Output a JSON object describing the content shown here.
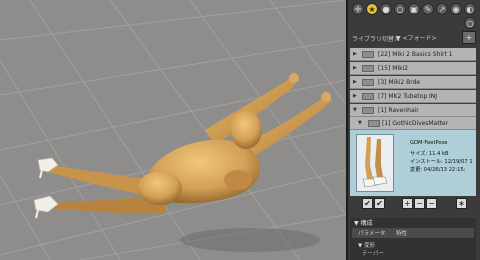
{
  "viewport": {
    "label": "3D viewport"
  },
  "toolbar": {
    "tools": [
      {
        "name": "pose-tool-icon",
        "glyph": "✛",
        "active": false
      },
      {
        "name": "library-tool-icon",
        "glyph": "★",
        "active": true
      },
      {
        "name": "sphere-tool-icon",
        "glyph": "●",
        "active": false
      },
      {
        "name": "light-tool-icon",
        "glyph": "○",
        "active": false
      },
      {
        "name": "camera-tool-icon",
        "glyph": "▣",
        "active": false
      },
      {
        "name": "paint-tool-icon",
        "glyph": "✎",
        "active": false
      },
      {
        "name": "scale-tool-icon",
        "glyph": "↗",
        "active": false
      },
      {
        "name": "render-tool-icon",
        "glyph": "◉",
        "active": false
      },
      {
        "name": "morph-tool-icon",
        "glyph": "◐",
        "active": false
      }
    ],
    "extra_glyph": "○"
  },
  "library": {
    "label": "ライブラリ切替え",
    "select_value": "▼ <フォード>",
    "add_glyph": "+"
  },
  "list": {
    "folders": [
      {
        "tri": "▶",
        "text": "[22]  Miki 2 Basics Shirt 1"
      },
      {
        "tri": "▶",
        "text": "[15]  Miki2"
      },
      {
        "tri": "▶",
        "text": "[3]   Miki2 Brde"
      },
      {
        "tri": "▶",
        "text": "[7]   MK2 Tubetop INJ"
      },
      {
        "tri": "▼",
        "text": "[1]   Ravenhair"
      },
      {
        "tri": "▼",
        "text": "[1]   GothicDivesMatter"
      }
    ],
    "item": {
      "name": "GDM-FeetPose",
      "size": "サイズ: 11.4 kB",
      "installed": "インストール: 12/19/07 1",
      "modified": "変更: 04/26/13 22:15:"
    }
  },
  "buttons": [
    "✔",
    "✔",
    "+",
    "−",
    "−",
    "∗"
  ],
  "properties": {
    "title": "▼ 構成",
    "tabs": [
      "パラメータ",
      "特性"
    ],
    "item1": "▼ 変形",
    "item2": "テーパー"
  },
  "colors": {
    "viewport_bg": "#8e8d8b",
    "skin": "#d7a55c",
    "skin_shadow": "#9c6d2d",
    "highlight": "#aeced8",
    "active_tool": "#e9c33a"
  }
}
